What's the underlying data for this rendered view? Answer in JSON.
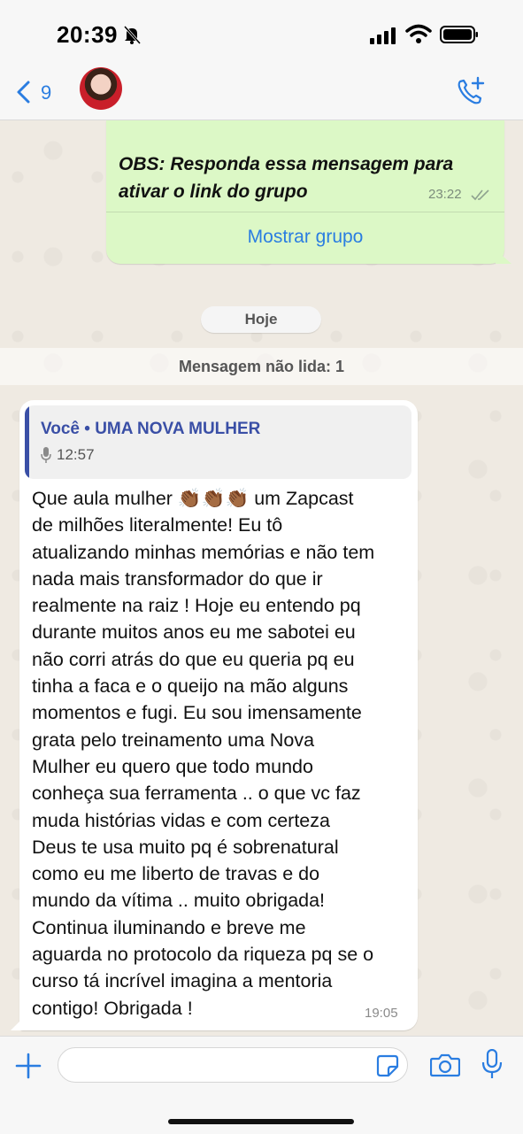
{
  "status_bar": {
    "time": "20:39"
  },
  "header": {
    "back_count": "9"
  },
  "outgoing": {
    "partial_top": "",
    "text": "OBS: Responda essa mensagem para ativar o link do grupo",
    "time": "23:22",
    "show_group_label": "Mostrar grupo"
  },
  "date_pill": "Hoje",
  "unread_label": "Mensagem não lida: 1",
  "incoming": {
    "quote_author": "Você • UMA NOVA MULHER",
    "quote_duration": "12:57",
    "text": "Que aula mulher 👏🏾👏🏾👏🏾 um Zapcast\nde milhões literalmente! Eu tô\natualizando minhas memórias e não tem\nnada mais transformador do que ir\nrealmente na raiz !  Hoje eu entendo pq\ndurante muitos anos eu me sabotei eu\nnão corri atrás do que eu queria pq eu\ntinha a faca e o queijo na mão alguns\nmomentos e fugi. Eu sou imensamente\ngrata pelo treinamento uma Nova\nMulher eu quero que todo mundo\nconheça sua ferramenta .. o que vc faz\nmuda histórias vidas e com certeza\nDeus te usa muito pq é sobrenatural\ncomo eu me liberto de travas e do\nmundo da vítima .. muito obrigada!\nContinua iluminando e breve me\naguarda no protocolo da riqueza pq se o\ncurso tá incrível imagina a mentoria\ncontigo! Obrigada !",
    "time": "19:05"
  },
  "input": {
    "placeholder": ""
  },
  "colors": {
    "accent": "#2a7de1",
    "outgoing_bubble": "#dcf8c6",
    "quote_bar": "#3a4fa6"
  },
  "icons": [
    "bell-slash-icon",
    "signal-icon",
    "wifi-icon",
    "battery-icon",
    "back-chevron-icon",
    "call-add-icon",
    "double-check-icon",
    "mic-icon",
    "plus-icon",
    "sticker-icon",
    "camera-icon"
  ]
}
